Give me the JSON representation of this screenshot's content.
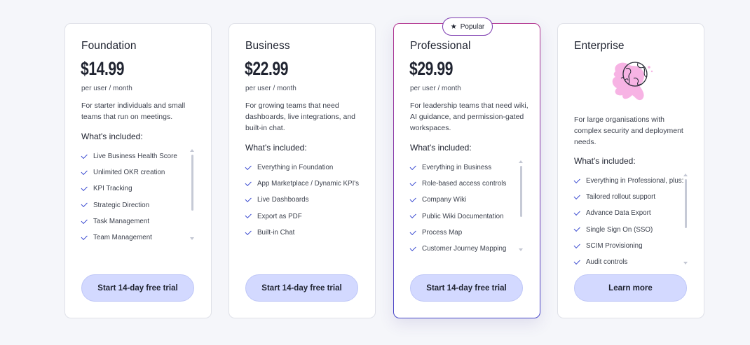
{
  "plans": [
    {
      "title": "Foundation",
      "price": "$14.99",
      "per": "per user / month",
      "description": "For starter individuals and small teams that run on meetings.",
      "included_heading": "What's included:",
      "features": [
        "Live Business Health Score",
        "Unlimited OKR creation",
        "KPI Tracking",
        "Strategic Direction",
        "Task Management",
        "Team Management"
      ],
      "cta": "Start 14-day free trial"
    },
    {
      "title": "Business",
      "price": "$22.99",
      "per": "per user / month",
      "description": "For growing teams that need dashboards, live integrations, and built-in chat.",
      "included_heading": "What's included:",
      "features": [
        "Everything in Foundation",
        "App Marketplace / Dynamic KPI's",
        "Live Dashboards",
        "Export as PDF",
        "Built-in Chat"
      ],
      "cta": "Start 14-day free trial"
    },
    {
      "title": "Professional",
      "badge": "Popular",
      "price": "$29.99",
      "per": "per user / month",
      "description": "For leadership teams that need wiki, AI guidance, and permission-gated workspaces.",
      "included_heading": "What's included:",
      "features": [
        "Everything in Business",
        "Role-based access controls",
        "Company Wiki",
        "Public Wiki Documentation",
        "Process Map",
        "Customer Journey Mapping"
      ],
      "cta": "Start 14-day free trial"
    },
    {
      "title": "Enterprise",
      "illustration": "globe-blob-illustration",
      "description": "For large organisations with complex security and deployment needs.",
      "included_heading": "What's included:",
      "features": [
        "Everything in Professional, plus:",
        "Tailored rollout support",
        "Advance Data Export",
        "Single Sign On (SSO)",
        "SCIM Provisioning",
        "Audit controls"
      ],
      "cta": "Learn more"
    }
  ],
  "colors": {
    "page_bg": "#f5f6fa",
    "cta_bg": "#d3d9ff",
    "check": "#3b4bd1",
    "popular_border_top": "#b2338f",
    "popular_border_bottom": "#4747c9"
  }
}
